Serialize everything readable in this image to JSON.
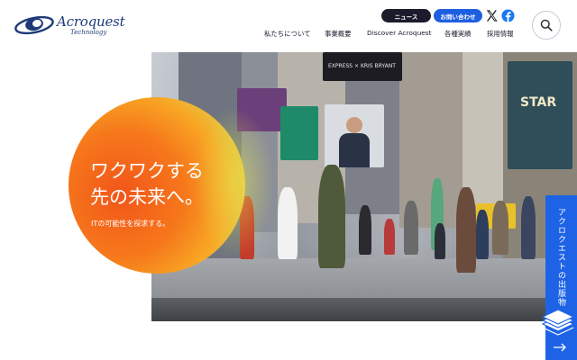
{
  "brand": {
    "name": "Acroquest",
    "tagline": "Technology"
  },
  "header": {
    "news_label": "ニュース",
    "contact_label": "お問い合わせ",
    "x_icon": "x-logo-icon",
    "facebook_icon": "facebook-icon",
    "search_icon": "search-icon"
  },
  "nav": {
    "items": [
      {
        "label": "私たちについて"
      },
      {
        "label": "事業概要"
      },
      {
        "label": "Discover Acroquest"
      },
      {
        "label": "各種実績"
      },
      {
        "label": "採用情報"
      }
    ]
  },
  "hero": {
    "headline_line1": "ワクワクする",
    "headline_line2": "先の未来へ。",
    "subline": "ITの可能性を探求する。",
    "photo_signs": {
      "sign1": "EXPRESS × KRIS BRYANT",
      "sign2": "STAR"
    }
  },
  "side_tab": {
    "label": "アクロクエストの出版物",
    "arrow_icon": "arrow-right-icon",
    "books_icon": "books-icon"
  },
  "colors": {
    "brand_navy": "#1e3a78",
    "accent_blue": "#1e63e6",
    "dark_pill": "#1b1b2b",
    "orb_orange": "#f6781b"
  }
}
